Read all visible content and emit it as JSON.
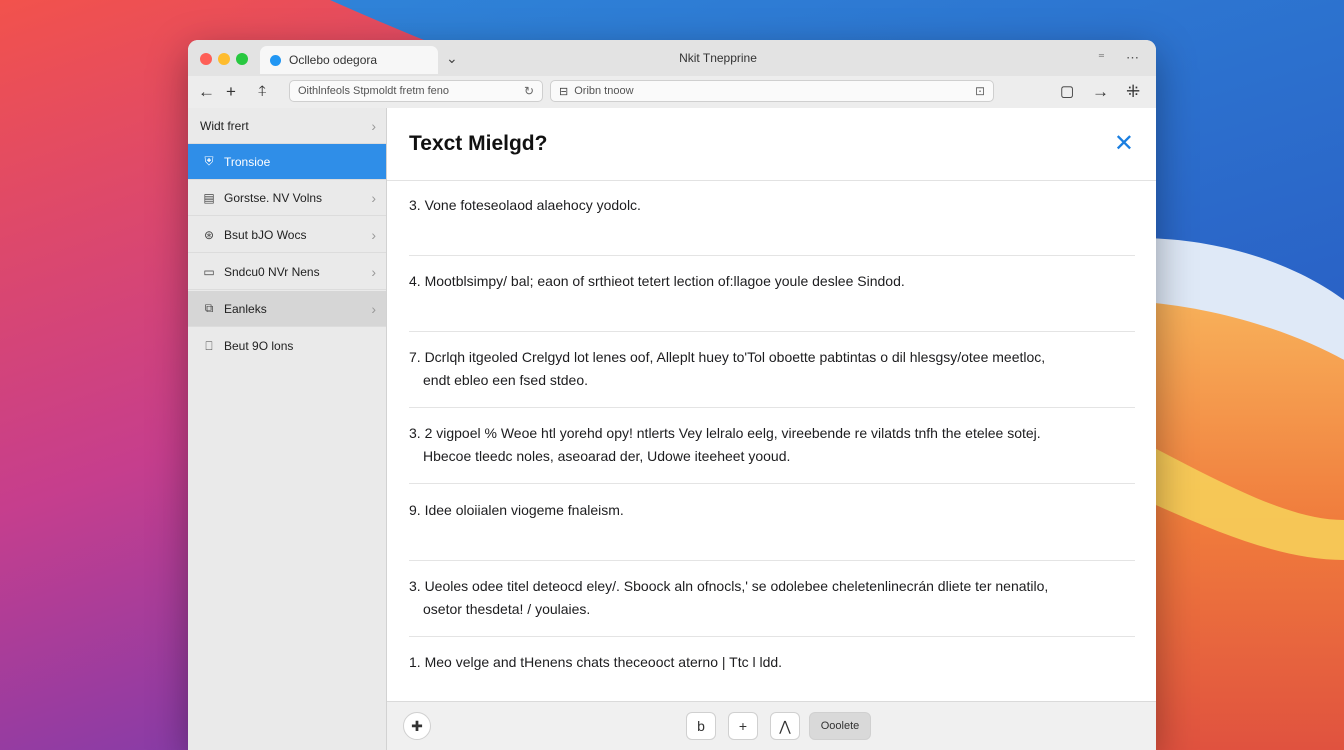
{
  "window": {
    "title": "Nkit Tnepprine",
    "tab_title": "Ocllebo odegora",
    "tab_chevron": "⌄",
    "right_icons": [
      "⁼",
      "⋯"
    ]
  },
  "toolbar": {
    "back": "←",
    "forward": "+",
    "extra": "⍏",
    "search_value": "Oithlnfeols Stpmoldt fretm feno",
    "search_icon": "refresh-icon",
    "address_value": "Oribn tnoow",
    "address_icon": "lock-icon",
    "right_buttons": [
      "share-icon",
      "forward-icon",
      "tools-icon"
    ]
  },
  "sidebar": {
    "items": [
      {
        "label": "Widt frert",
        "icon": "",
        "chevron": "›"
      },
      {
        "label": "Tronsioe",
        "icon": "shield-icon",
        "chevron": "",
        "state": "active"
      },
      {
        "label": "Gorstse. NV Volns",
        "icon": "window-icon",
        "chevron": "›"
      },
      {
        "label": "Bsut bJO Wocs",
        "icon": "globe-icon",
        "chevron": "›"
      },
      {
        "label": "Sndcu0 NVr Nens",
        "icon": "monitor-icon",
        "chevron": "›"
      },
      {
        "label": "Eanleks",
        "icon": "box-icon",
        "chevron": "›",
        "state": "hover"
      },
      {
        "label": "Beut 9O lons",
        "icon": "file-icon",
        "chevron": ""
      }
    ]
  },
  "content": {
    "title": "Texct Mielgd?",
    "close": "✕",
    "items": [
      {
        "line1": "3. Vone foteseolaod alaehocy yodolc.",
        "line2": ""
      },
      {
        "line1": "4. Mootblsimpy/ bal; eaon of srthieot tetert lection of:llagoe youle deslee Sindod.",
        "line2": ""
      },
      {
        "line1": "7. Dcrlqh itgeoled Crelgyd lot lenes oof, Alleplt huey to'Tol oboette pabtintas o dil hlesgsy/otee meetloc,",
        "line2": "endt ebleo een fsed stdeo."
      },
      {
        "line1": "3. 2 vigpoel % Weoe htl yorehd opy! ntlerts Vey lelralo eelg, vireebende re vilatds tnfh the etelee sotej.",
        "line2": "Hbecoe tleedc noles, aseoarad der, Udowe iteeheet yooud."
      },
      {
        "line1": "9. Idee oloiialen viogeme fnaleism.",
        "line2": ""
      },
      {
        "line1": "3. Ueoles odee titel deteocd eley/. Sboock aln ofnocls,' se odolebee cheletenlinecrán dliete ter nenatilo,",
        "line2": "osetor thesdeta! / youlaies."
      },
      {
        "line1": "1. Meo velge and tHenens chats theceooct aterno | Ttc l ldd.",
        "line2": ""
      }
    ]
  },
  "footer": {
    "left_icon": "plus-icon",
    "buttons": [
      "b",
      "+",
      "⋀"
    ],
    "action_label": "Ooolete"
  },
  "colors": {
    "accent": "#2f8ee8",
    "close": "#1a7ee0"
  }
}
